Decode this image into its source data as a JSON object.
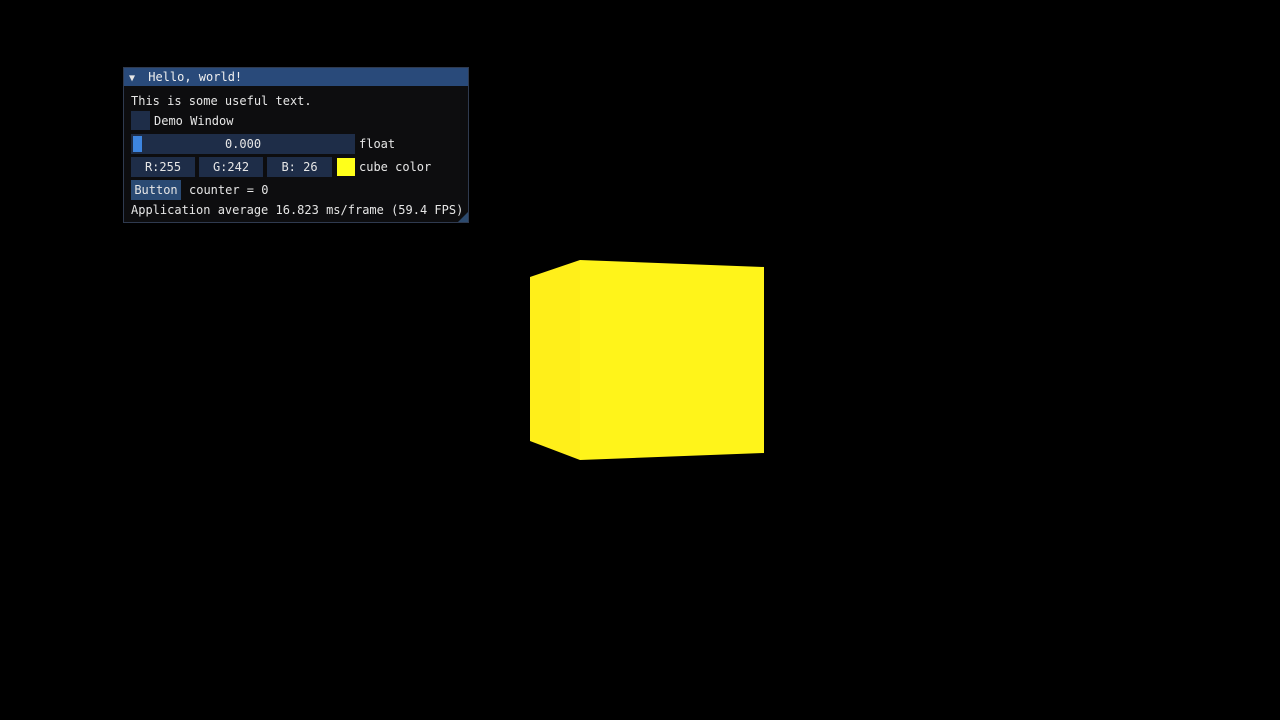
{
  "window": {
    "title": "Hello, world!",
    "text_line": "This is some useful text.",
    "checkbox_label": "Demo Window",
    "checkbox_checked": false,
    "slider_value": "0.000",
    "slider_label": "float",
    "color_r": "R:255",
    "color_g": "G:242",
    "color_b": "B: 26",
    "color_label": "cube color",
    "button_label": "Button",
    "counter_text": "counter = 0",
    "fps_text": "Application average 16.823 ms/frame (59.4 FPS)"
  },
  "colors": {
    "cube": "#ffff1a",
    "background": "#000000",
    "titlebar": "#294a7a",
    "frame": "#1e2d48",
    "slider_grab": "#3d85e0"
  },
  "scene": {
    "object": "cube"
  }
}
